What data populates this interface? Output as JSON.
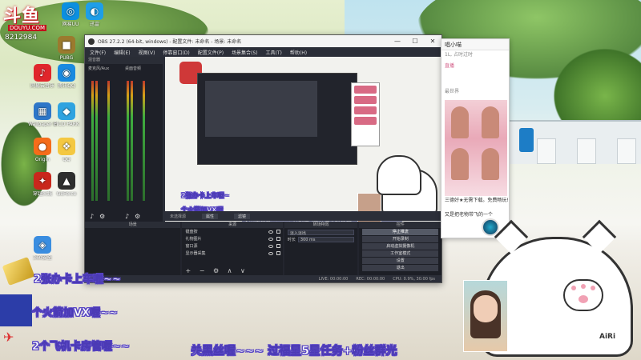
{
  "brand": {
    "logo_text": "斗鱼",
    "logo_sub": "DOUYU.COM",
    "uid": "8212984"
  },
  "desktop_icons": [
    {
      "label": "网易云音乐",
      "color": "#e0262b",
      "glyph": "♪"
    },
    {
      "label": "腾讯QQ",
      "color": "#1a8ae0",
      "glyph": "◉"
    },
    {
      "label": "Wallpaper Engine",
      "color": "#2d76c8",
      "glyph": "▦"
    },
    {
      "label": "PICO PARK",
      "color": "#2fa3e0",
      "glyph": "◆"
    },
    {
      "label": "Origin",
      "color": "#f56c1a",
      "glyph": "●"
    },
    {
      "label": "QQ",
      "color": "#f4c842",
      "glyph": "❖"
    },
    {
      "label": "穿越火线",
      "color": "#c9271c",
      "glyph": "✦"
    },
    {
      "label": "GeForce",
      "color": "#2e2e2e",
      "glyph": "▲"
    },
    {
      "label": "360安全",
      "color": "#3a8de0",
      "glyph": "◈"
    },
    {
      "label": "PUBG",
      "color": "#9b7a2e",
      "glyph": "■"
    },
    {
      "label": "网易UU",
      "color": "#0c8fe0",
      "glyph": "◎"
    },
    {
      "label": "迅雷",
      "color": "#1e9ee8",
      "glyph": "◐"
    }
  ],
  "obs": {
    "title": "OBS 27.2.2 (64-bit, windows) - 配置文件: 未命名 - 场景: 未命名",
    "menu": [
      "文件(F)",
      "编辑(E)",
      "视图(V)",
      "停靠窗口(D)",
      "配置文件(P)",
      "场景集合(S)",
      "工具(T)",
      "帮助(H)"
    ],
    "mixer_label": "混音器",
    "mixer_channels": [
      "麦克风/Aux",
      "桌面音频"
    ],
    "status_left": "未选择源",
    "status_tab_props": "属性",
    "status_tab_filters": "滤镜",
    "scenes_header": "场景",
    "sources_header": "来源",
    "sources": [
      "键盘按",
      "礼物图片",
      "窗口源",
      "显示器采集"
    ],
    "transitions_header": "转场特效",
    "transition_type": "淡入淡出",
    "duration_label": "时长",
    "duration_value": "300 ms",
    "controls_header": "控件",
    "controls": [
      "停止推流",
      "开始录制",
      "启动虚拟摄像机",
      "工作室模式",
      "设置",
      "退出"
    ],
    "bottom_stats": [
      "LIVE: 00:00:00",
      "REC: 00:00:00",
      "CPU: 0.9%, 30.00 fps"
    ]
  },
  "preview": {
    "banner": "关的黑丝喔 ~ ~ ~ 过福星5星任务+粉丝群",
    "chat_line1": "2张办卡上车喔~",
    "chat_line2": "个火箭加VX喔"
  },
  "chat": {
    "title": "唱小喵",
    "sub": "1L, 占时过时",
    "tag": "直播",
    "msg1": "三德好★无需下载。免费畅玩!",
    "msg2": "又是把老物带飞的一个",
    "store_label": "最世界"
  },
  "overlay": {
    "line1": "2张办卡上车喔~~",
    "line2": "个火箭加VX喔~~",
    "line3": "2个飞机卡房管喔~~",
    "marquee": "关黑丝喔~~~ 过福星5星任务+粉丝群光"
  },
  "watermark": "AiRi"
}
